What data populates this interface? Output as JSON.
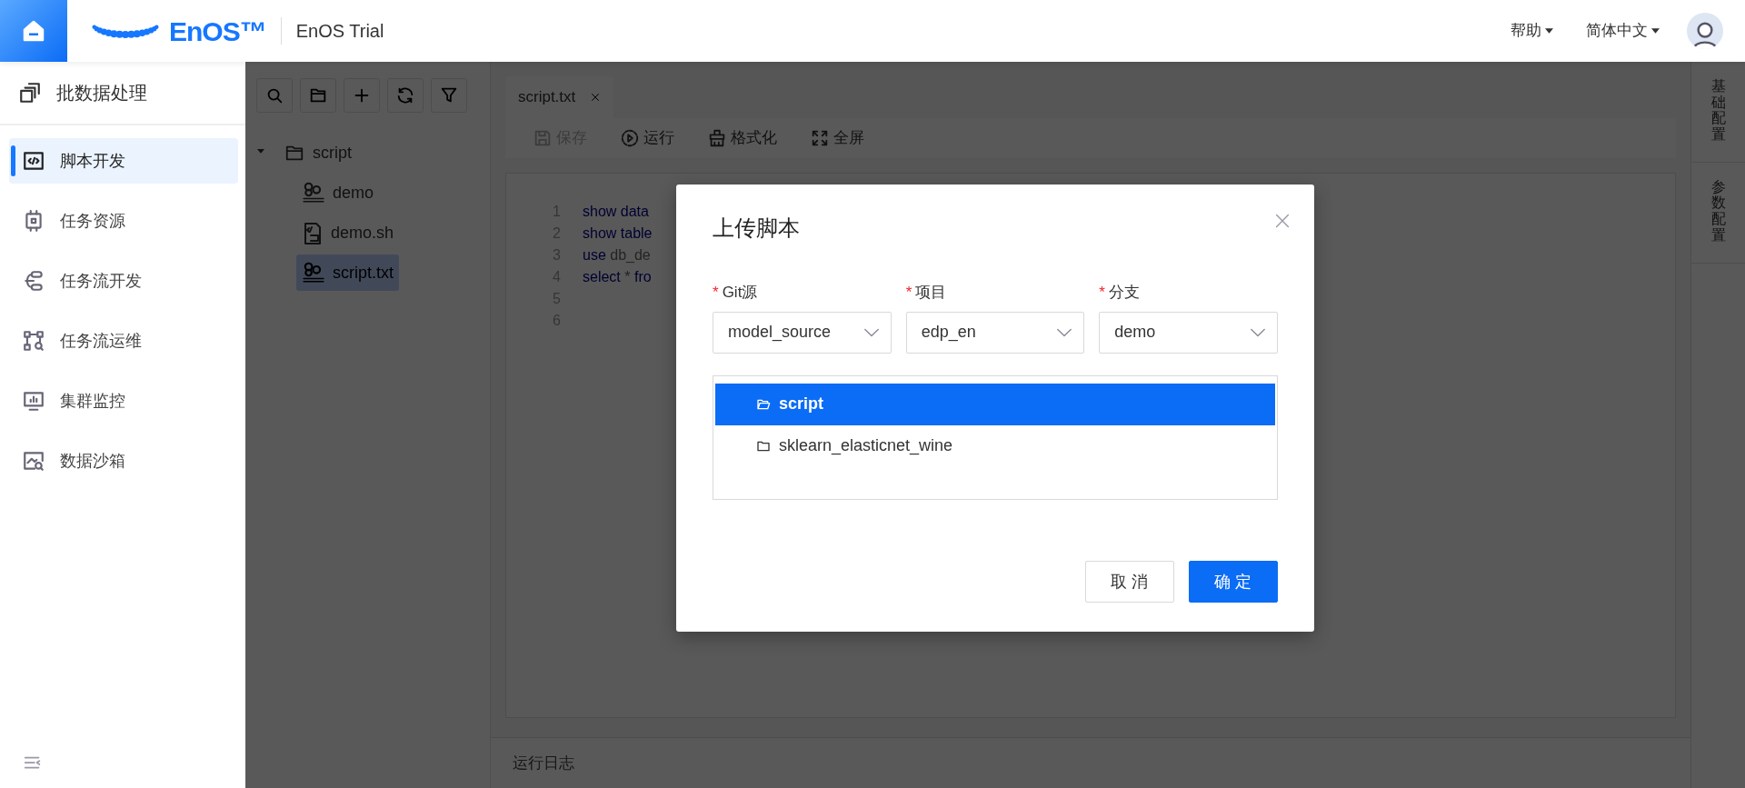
{
  "header": {
    "logo": "EnOS™",
    "app_title": "EnOS Trial",
    "menus": [
      "帮助",
      "简体中文"
    ]
  },
  "sidebar": {
    "title": "批数据处理",
    "items": [
      {
        "label": "脚本开发",
        "selected": true
      },
      {
        "label": "任务资源",
        "selected": false
      },
      {
        "label": "任务流开发",
        "selected": false
      },
      {
        "label": "任务流运维",
        "selected": false
      },
      {
        "label": "集群监控",
        "selected": false
      },
      {
        "label": "数据沙箱",
        "selected": false
      }
    ]
  },
  "file_tree": [
    {
      "label": "script",
      "kind": "folder",
      "expanded": true,
      "selected": false,
      "children": [
        {
          "label": "demo",
          "kind": "hive",
          "selected": false
        },
        {
          "label": "demo.sh",
          "kind": "shell",
          "selected": false
        },
        {
          "label": "script.txt",
          "kind": "hive",
          "selected": true
        }
      ]
    }
  ],
  "editor": {
    "tabs": [
      {
        "label": "script.txt",
        "selected": true
      }
    ],
    "toolbar": [
      {
        "label": "保存",
        "disabled": true
      },
      {
        "label": "运行",
        "disabled": false
      },
      {
        "label": "格式化",
        "disabled": false
      },
      {
        "label": "全屏",
        "disabled": false
      }
    ],
    "code_lines": [
      {
        "number": "1",
        "tokens": [
          {
            "text": "show data",
            "kind": "keyword"
          }
        ]
      },
      {
        "number": "2",
        "tokens": [
          {
            "text": "show table",
            "kind": "keyword"
          }
        ]
      },
      {
        "number": "3",
        "tokens": [
          {
            "text": "use",
            "kind": "keyword"
          },
          {
            "text": "db_de",
            "kind": "plain"
          }
        ]
      },
      {
        "number": "4",
        "tokens": [
          {
            "text": "select",
            "kind": "keyword"
          },
          {
            "text": "*",
            "kind": "plain"
          },
          {
            "text": "fro",
            "kind": "keyword"
          }
        ]
      },
      {
        "number": "5"
      },
      {
        "number": "6"
      }
    ],
    "log_bar": "运行日志"
  },
  "side_tabs": [
    "基础配置",
    "参数配置"
  ],
  "dialog": {
    "title": "上传脚本",
    "fields": [
      {
        "label": "Git源",
        "value": "model_source",
        "required": true
      },
      {
        "label": "项目",
        "value": "edp_en",
        "required": true
      },
      {
        "label": "分支",
        "value": "demo",
        "required": true
      }
    ],
    "folders": [
      {
        "label": "script",
        "selected": true
      },
      {
        "label": "sklearn_elasticnet_wine",
        "selected": false
      }
    ],
    "buttons": [
      {
        "label": "取 消",
        "kind": "secondary"
      },
      {
        "label": "确 定",
        "kind": "primary"
      }
    ]
  }
}
